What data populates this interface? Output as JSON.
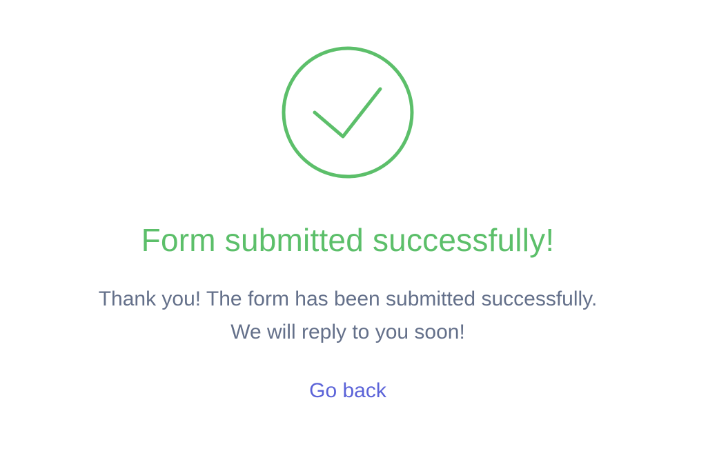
{
  "icon": {
    "name": "check-circle-icon",
    "color": "#5cbf6a"
  },
  "title": "Form submitted successfully!",
  "message": {
    "line1": "Thank you! The form has been submitted successfully.",
    "line2": "We will reply to you soon!"
  },
  "link": {
    "label": "Go back"
  },
  "colors": {
    "success": "#5cbf6a",
    "text": "#64708a",
    "link": "#5b63d8"
  }
}
